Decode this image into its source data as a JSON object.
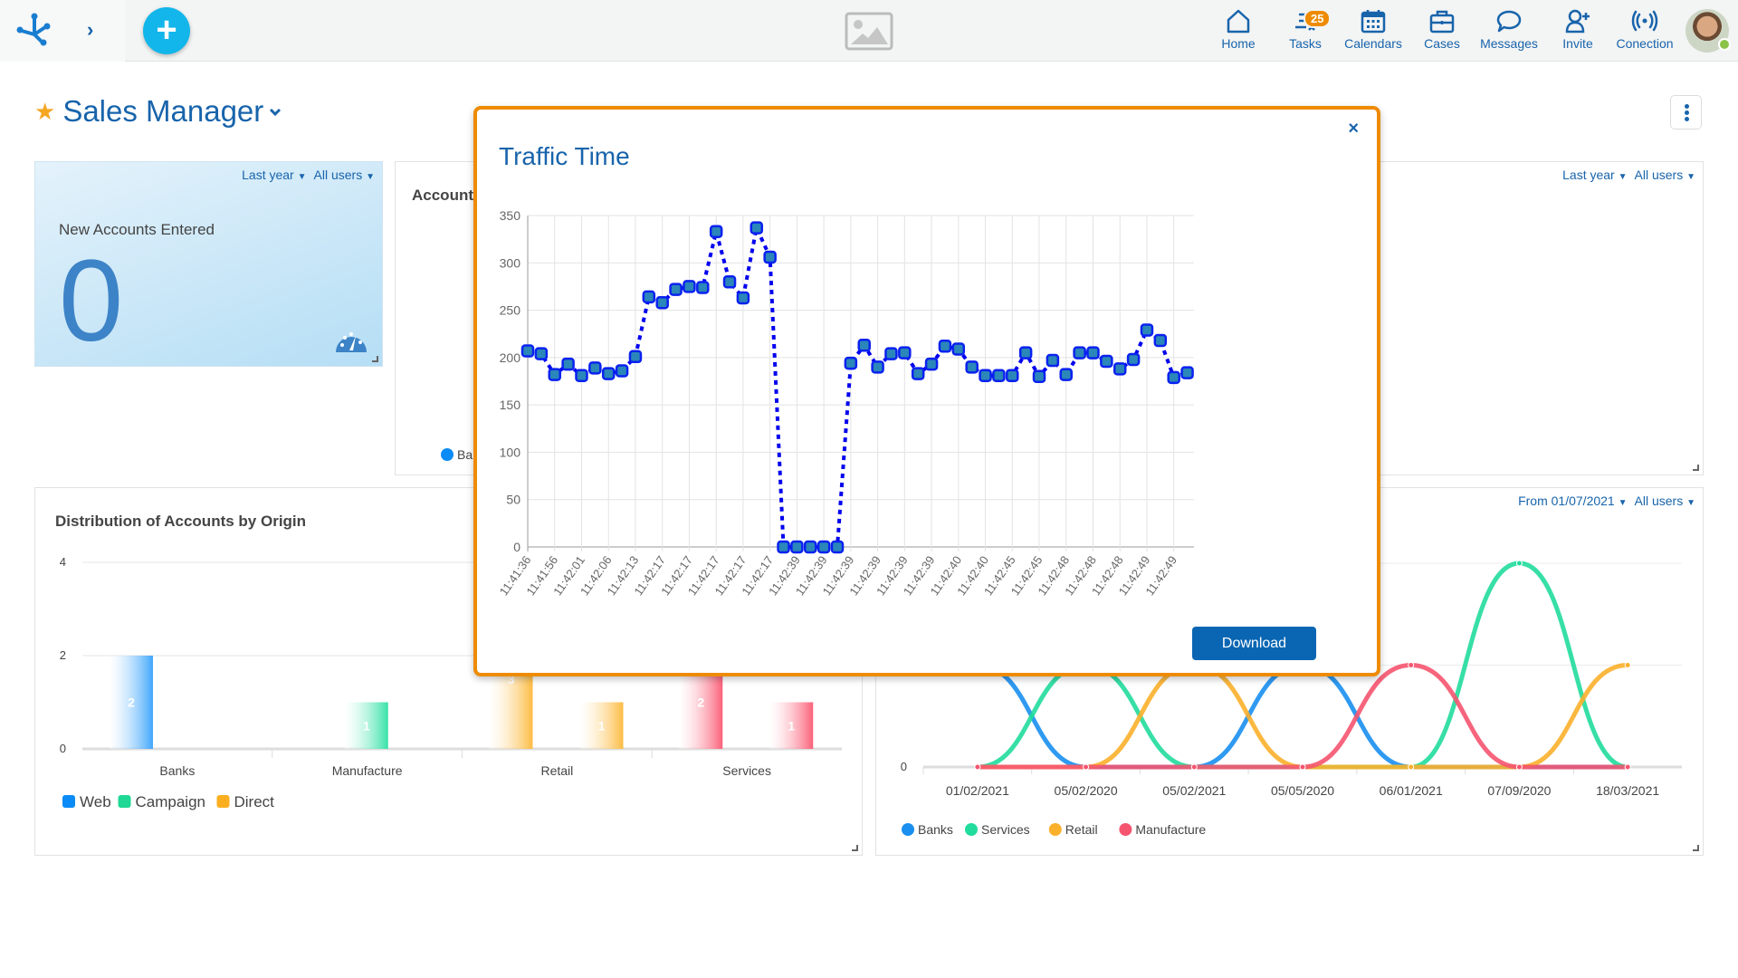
{
  "header": {
    "expand_glyph": "›",
    "add_glyph": "+",
    "nav": [
      {
        "id": "home",
        "label": "Home",
        "icon": "home-icon"
      },
      {
        "id": "tasks",
        "label": "Tasks",
        "icon": "tasks-icon",
        "badge": "25"
      },
      {
        "id": "calendars",
        "label": "Calendars",
        "icon": "calendar-icon"
      },
      {
        "id": "cases",
        "label": "Cases",
        "icon": "briefcase-icon"
      },
      {
        "id": "messages",
        "label": "Messages",
        "icon": "chat-bubble-icon"
      },
      {
        "id": "invite",
        "label": "Invite",
        "icon": "add-user-icon"
      },
      {
        "id": "conection",
        "label": "Conection",
        "icon": "broadcast-icon"
      }
    ]
  },
  "page": {
    "title": "Sales Manager",
    "star_glyph": "★",
    "chevron_glyph": "⌄"
  },
  "widgets": {
    "kpi": {
      "title": "New Accounts Entered",
      "value": "0",
      "filter_period": "Last year",
      "filter_users": "All users"
    },
    "accounts": {
      "title": "Accounts",
      "legend_first": "Ba",
      "filter_period": "Last year",
      "filter_users": "All users"
    },
    "distribution": {
      "title": "Distribution of Accounts by Origin"
    },
    "trend": {
      "filter_period": "From 01/07/2021",
      "filter_users": "All users"
    }
  },
  "modal": {
    "title": "Traffic Time",
    "close_glyph": "×",
    "download_label": "Download"
  },
  "colors": {
    "brand": "#1864ab",
    "accent": "#ee8b00",
    "add_button": "#13b6ea",
    "traffic_line": "#0000ee"
  },
  "chart_data": [
    {
      "id": "traffic-time",
      "type": "line",
      "title": "Traffic Time",
      "xlabel": "",
      "ylabel": "",
      "ylim": [
        0,
        350
      ],
      "yticks": [
        0,
        50,
        100,
        150,
        200,
        250,
        300,
        350
      ],
      "grid": true,
      "x_tick_labels": [
        "11:41:36",
        "11:41:56",
        "11:42:01",
        "11:42:06",
        "11:42:13",
        "11:42:17",
        "11:42:17",
        "11:42:17",
        "11:42:17",
        "11:42:17",
        "11:42:39",
        "11:42:39",
        "11:42:39",
        "11:42:39",
        "11:42:39",
        "11:42:39",
        "11:42:40",
        "11:42:40",
        "11:42:45",
        "11:42:45",
        "11:42:48",
        "11:42:48",
        "11:42:48",
        "11:42:49",
        "11:42:49"
      ],
      "series": [
        {
          "name": "Traffic",
          "style": "dotted",
          "values": [
            207,
            204,
            182,
            193,
            181,
            189,
            183,
            186,
            201,
            264,
            258,
            272,
            275,
            274,
            333,
            280,
            263,
            337,
            306,
            0,
            0,
            0,
            0,
            0,
            194,
            213,
            190,
            204,
            205,
            183,
            193,
            212,
            209,
            190,
            181,
            181,
            181,
            205,
            180,
            197,
            182,
            205,
            205,
            196,
            188,
            198,
            229,
            218,
            179,
            184
          ]
        }
      ]
    },
    {
      "id": "distribution",
      "type": "bar",
      "title": "Distribution of Accounts by Origin",
      "categories": [
        "Banks",
        "Manufacture",
        "Retail",
        "Services"
      ],
      "ylim": [
        0,
        4
      ],
      "yticks": [
        0,
        2,
        4
      ],
      "legend": [
        "Web",
        "Campaign",
        "Direct"
      ],
      "legend_colors": [
        "#0b8bf5",
        "#1fd896",
        "#fbaf20"
      ],
      "legend_position": "bottom-left",
      "series": [
        {
          "name": "Web",
          "values": [
            2,
            0,
            3,
            2
          ]
        },
        {
          "name": "Campaign",
          "values": [
            0,
            1,
            0,
            0
          ]
        },
        {
          "name": "Direct",
          "values": [
            0,
            0,
            1,
            1
          ]
        }
      ],
      "category_colors": [
        "#3fa6fb",
        "#37e2a8",
        "#fdbc43",
        "#fb6079"
      ]
    },
    {
      "id": "accounts-trend",
      "type": "line",
      "title": "",
      "categories": [
        "01/02/2021",
        "05/02/2020",
        "05/02/2021",
        "05/05/2020",
        "06/01/2021",
        "07/09/2020",
        "18/03/2021"
      ],
      "ylim": [
        0,
        4
      ],
      "yticks": [
        0
      ],
      "legend_position": "bottom-left",
      "series": [
        {
          "name": "Banks",
          "color": "#1a8ff0",
          "values": [
            2,
            0,
            0,
            2,
            0,
            0,
            0
          ]
        },
        {
          "name": "Services",
          "color": "#21dc9c",
          "values": [
            0,
            2,
            0,
            0,
            0,
            4,
            0
          ]
        },
        {
          "name": "Retail",
          "color": "#fbb02b",
          "values": [
            0,
            0,
            2,
            0,
            0,
            0,
            2
          ]
        },
        {
          "name": "Manufacture",
          "color": "#f5546f",
          "values": [
            0,
            0,
            0,
            0,
            2,
            0,
            0
          ]
        }
      ]
    }
  ]
}
